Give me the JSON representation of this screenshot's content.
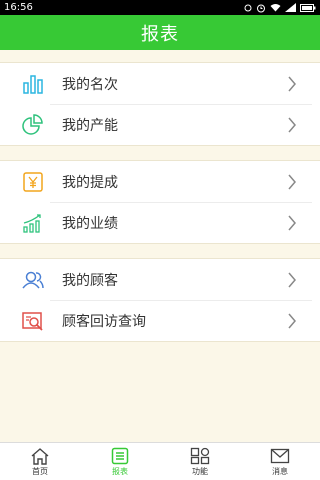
{
  "status_bar": {
    "time": "16:56"
  },
  "header": {
    "title": "报表"
  },
  "groups": [
    {
      "items": [
        {
          "label": "我的名次",
          "icon": "bar-chart-icon"
        },
        {
          "label": "我的产能",
          "icon": "pie-chart-icon"
        }
      ]
    },
    {
      "items": [
        {
          "label": "我的提成",
          "icon": "yuan-icon"
        },
        {
          "label": "我的业绩",
          "icon": "growth-chart-icon"
        }
      ]
    },
    {
      "items": [
        {
          "label": "我的顾客",
          "icon": "customers-icon"
        },
        {
          "label": "顾客回访查询",
          "icon": "search-record-icon"
        }
      ]
    }
  ],
  "tabs": [
    {
      "label": "首页",
      "icon": "home-icon",
      "active": false
    },
    {
      "label": "报表",
      "icon": "report-icon",
      "active": true
    },
    {
      "label": "功能",
      "icon": "grid-icon",
      "active": false
    },
    {
      "label": "消息",
      "icon": "mail-icon",
      "active": false
    }
  ],
  "colors": {
    "accent": "#37c935",
    "background": "#fbf7e8"
  }
}
